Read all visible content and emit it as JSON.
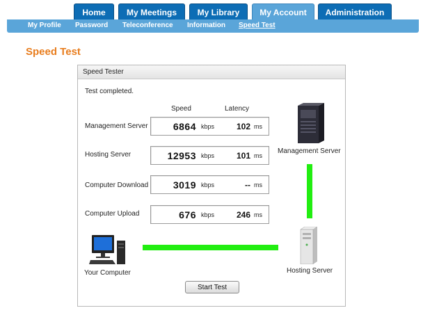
{
  "tabs": [
    {
      "label": "Home"
    },
    {
      "label": "My Meetings"
    },
    {
      "label": "My Library"
    },
    {
      "label": "My Account"
    },
    {
      "label": "Administration"
    }
  ],
  "subnav": [
    {
      "label": "My Profile"
    },
    {
      "label": "Password"
    },
    {
      "label": "Teleconference"
    },
    {
      "label": "Information"
    },
    {
      "label": "Speed Test"
    }
  ],
  "page_title": "Speed Test",
  "panel": {
    "title": "Speed Tester",
    "status": "Test completed.",
    "col_speed": "Speed",
    "col_latency": "Latency",
    "rows": [
      {
        "label": "Management Server",
        "speed": "6864",
        "speed_unit": "kbps",
        "latency": "102",
        "latency_unit": "ms"
      },
      {
        "label": "Hosting Server",
        "speed": "12953",
        "speed_unit": "kbps",
        "latency": "101",
        "latency_unit": "ms"
      },
      {
        "label": "Computer Download",
        "speed": "3019",
        "speed_unit": "kbps",
        "latency": "--",
        "latency_unit": "ms"
      },
      {
        "label": "Computer Upload",
        "speed": "676",
        "speed_unit": "kbps",
        "latency": "246",
        "latency_unit": "ms"
      }
    ],
    "devices": {
      "management_server": "Management Server",
      "hosting_server": "Hosting Server",
      "your_computer": "Your Computer"
    },
    "start_button": "Start Test",
    "link_color": "#22ee11"
  },
  "colors": {
    "tab_bg": "#0d6db5",
    "tab_active_bg": "#5aa5d9",
    "title_orange": "#e87d1e"
  }
}
